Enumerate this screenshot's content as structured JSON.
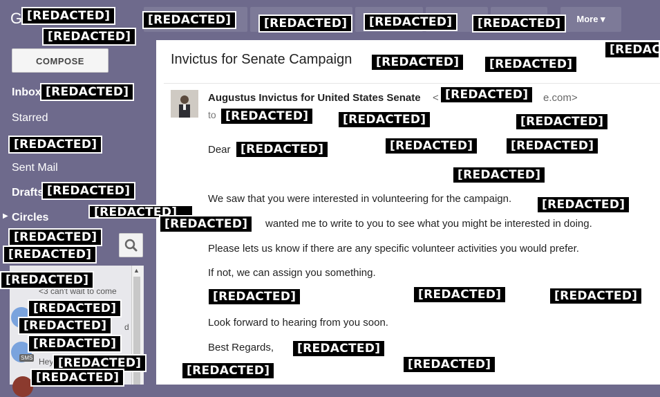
{
  "topbar": {
    "logo": "G",
    "more_label": "More ▾"
  },
  "sidebar": {
    "compose": "COMPOSE",
    "inbox": "Inbox",
    "starred": "Starred",
    "sent": "Sent Mail",
    "drafts": "Drafts",
    "circles": "Circles",
    "chats": [
      {
        "preview": "<3 can't wait to come"
      },
      {
        "preview": "d"
      },
      {
        "badge": "SMS",
        "preview": "Hey"
      }
    ]
  },
  "email": {
    "subject": "Invictus for Senate Campaign",
    "sender": "Augustus Invictus for United States Senate",
    "sender_email_fragment": "<",
    "sender_email_suffix": "e.com>",
    "to": "to",
    "greeting": "Dear",
    "paragraphs": [
      "We saw that you were interested in volunteering for the campaign.",
      "wanted me to write to you to see what you might be interested in doing.",
      "Please lets us know if there are any specific volunteer activities you would prefer.",
      "If not, we can assign you something.",
      "Look forward to hearing from you soon.",
      "Best Regards,"
    ]
  },
  "redacted_label": "[REDACTED]",
  "redacted_label_partial": "[REDACTED]",
  "redacted_label_d": "[REDACTED]"
}
